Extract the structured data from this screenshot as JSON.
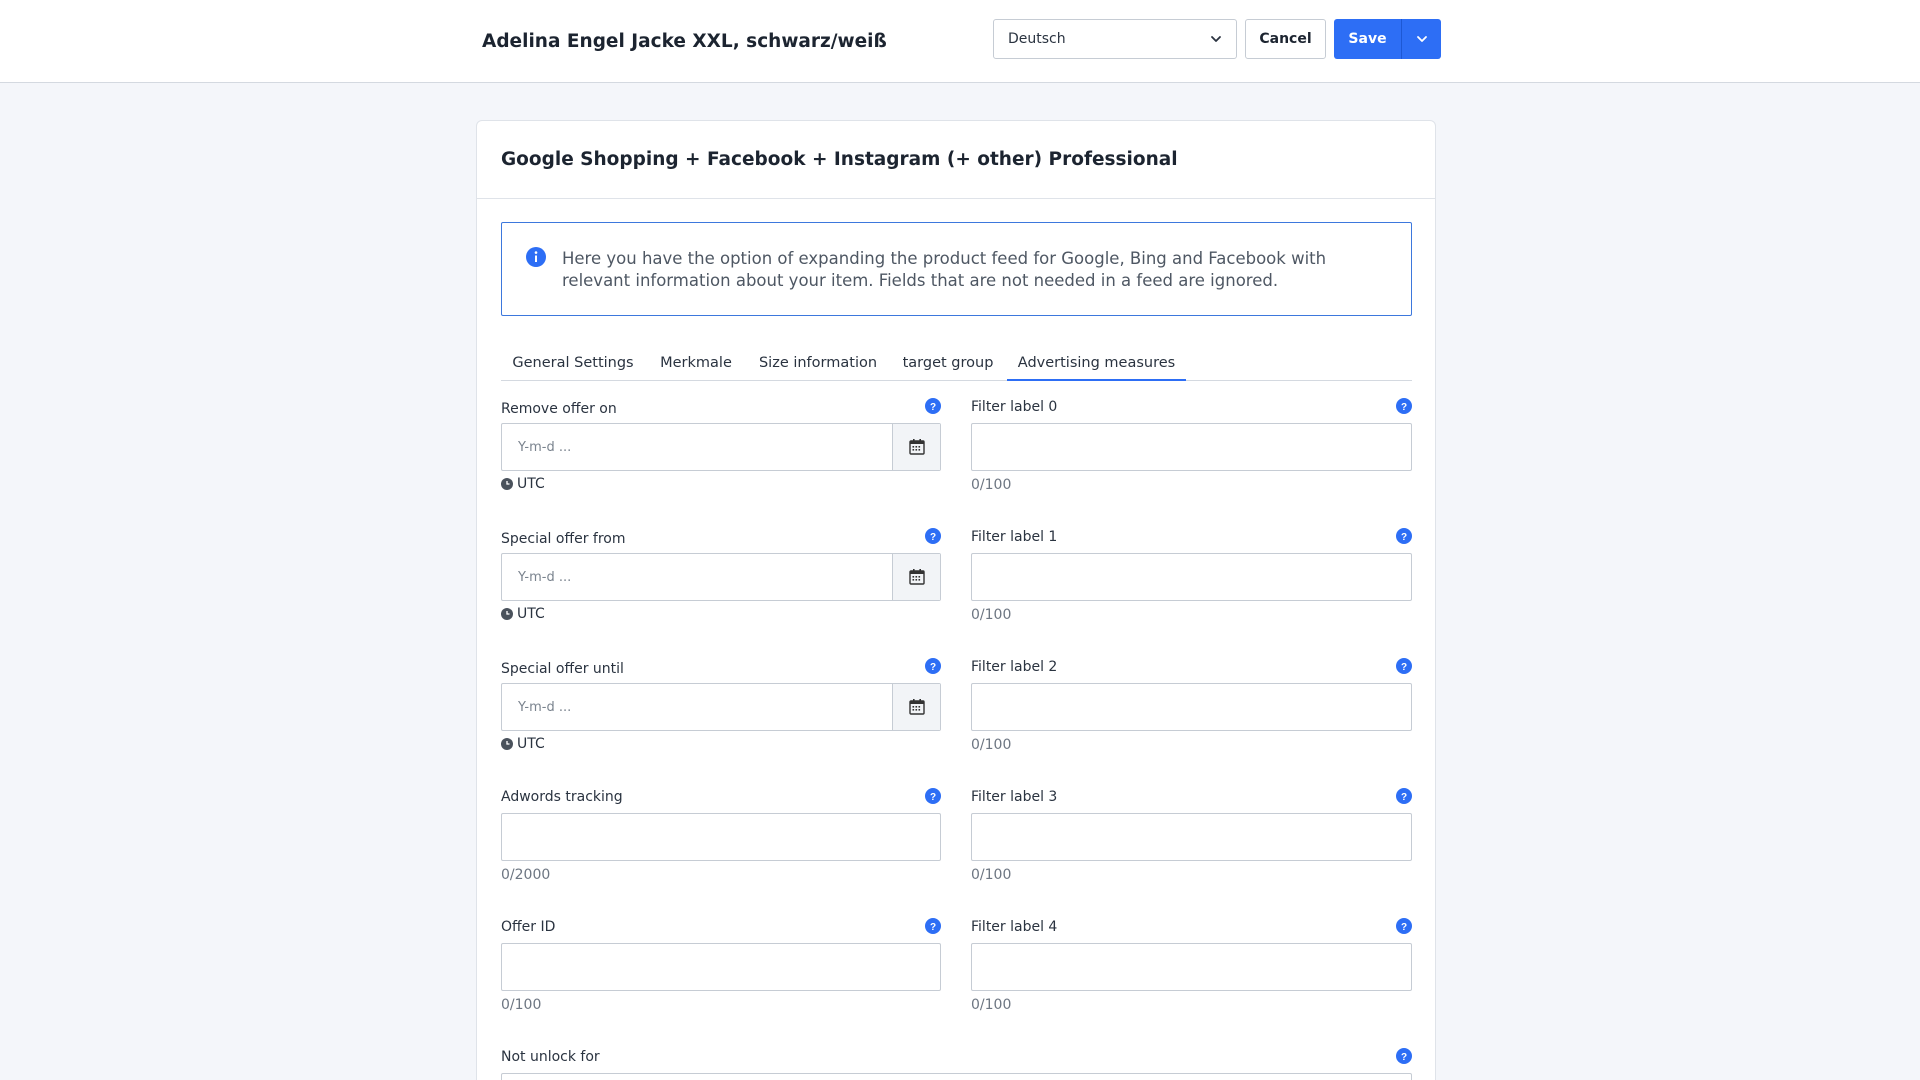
{
  "header": {
    "product_title": "Adelina Engel Jacke XXL, schwarz/weiß",
    "language": "Deutsch",
    "cancel_label": "Cancel",
    "save_label": "Save"
  },
  "card": {
    "title": "Google Shopping + Facebook + Instagram (+ other) Professional",
    "info_text": "Here you have the option of expanding the product feed for Google, Bing and Facebook with relevant information about your item. Fields that are not needed in a feed are ignored."
  },
  "tabs": [
    {
      "label": "General Settings"
    },
    {
      "label": "Merkmale"
    },
    {
      "label": "Size information"
    },
    {
      "label": "target group"
    },
    {
      "label": "Advertising measures",
      "active": true
    }
  ],
  "left_fields": {
    "remove_offer": {
      "label": "Remove offer on",
      "placeholder": "Y-m-d ...",
      "timezone": "UTC"
    },
    "special_from": {
      "label": "Special offer from",
      "placeholder": "Y-m-d ...",
      "timezone": "UTC"
    },
    "special_until": {
      "label": "Special offer until",
      "placeholder": "Y-m-d ...",
      "timezone": "UTC"
    },
    "adwords": {
      "label": "Adwords tracking",
      "value": "",
      "counter": "0/2000"
    },
    "offer_id": {
      "label": "Offer ID",
      "value": "",
      "counter": "0/100"
    },
    "not_unlock": {
      "label": "Not unlock for"
    }
  },
  "filter_labels": [
    {
      "label": "Filter label 0",
      "value": "",
      "counter": "0/100"
    },
    {
      "label": "Filter label 1",
      "value": "",
      "counter": "0/100"
    },
    {
      "label": "Filter label 2",
      "value": "",
      "counter": "0/100"
    },
    {
      "label": "Filter label 3",
      "value": "",
      "counter": "0/100"
    },
    {
      "label": "Filter label 4",
      "value": "",
      "counter": "0/100"
    }
  ],
  "colors": {
    "accent": "#2d6ef5",
    "info_border": "#3d78dd",
    "page_bg": "#f4f6fa"
  },
  "icons": [
    "chevron-down-icon",
    "info-icon",
    "help-icon",
    "calendar-icon",
    "clock-icon"
  ]
}
